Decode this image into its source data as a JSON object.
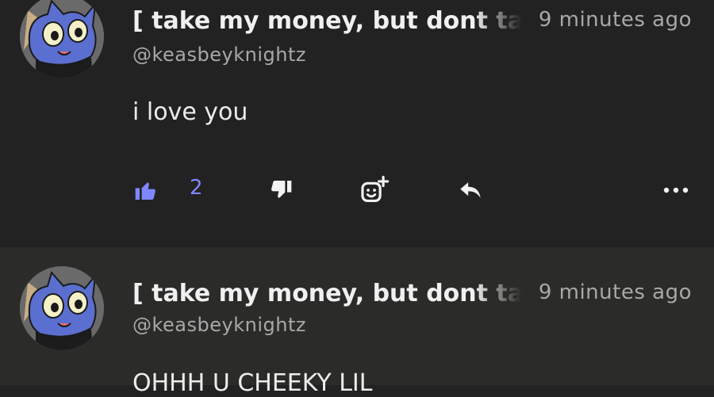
{
  "posts": [
    {
      "author": "[ take my money, but dont take my heart ]",
      "handle": "@keasbeyknightz",
      "time": "9 minutes ago",
      "text": "i love you",
      "likes": "2"
    },
    {
      "author": "[ take my money, but dont take my heart ]",
      "handle": "@keasbeyknightz",
      "time": "9 minutes ago",
      "text": "OHHH U CHEEKY LIL"
    }
  ],
  "icons": {
    "like": "thumbs-up-icon",
    "dislike": "thumbs-down-icon",
    "react": "add-reaction-icon",
    "reply": "reply-icon",
    "more": "more-icon"
  },
  "colors": {
    "background": "#232222",
    "background_alt": "#2b2b29",
    "accent": "#8088ff",
    "muted_text": "#a8a8a8"
  }
}
